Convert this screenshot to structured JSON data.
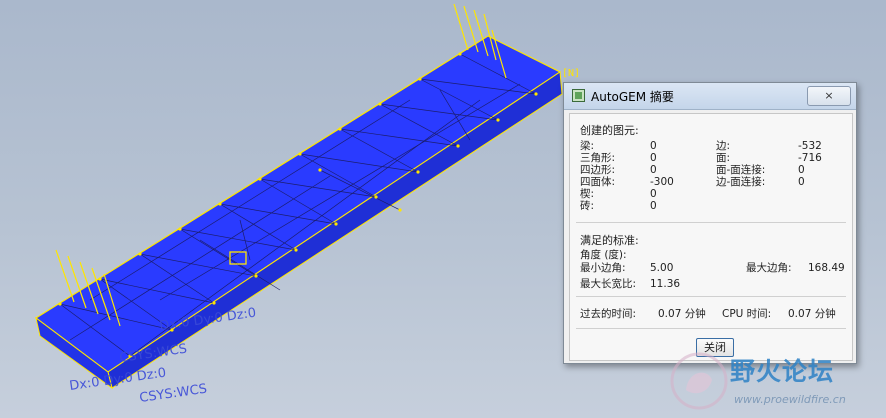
{
  "dialog": {
    "title": "AutoGEM 摘要",
    "close_label": "×",
    "created_heading": "创建的图元:",
    "created_left": [
      {
        "label": "梁:",
        "value": "0"
      },
      {
        "label": "三角形:",
        "value": "0"
      },
      {
        "label": "四边形:",
        "value": "0"
      },
      {
        "label": "四面体:",
        "value": "-300"
      },
      {
        "label": "楔:",
        "value": "0"
      },
      {
        "label": "砖:",
        "value": "0"
      }
    ],
    "created_right": [
      {
        "label": "边:",
        "value": "-532"
      },
      {
        "label": "面:",
        "value": "-716"
      },
      {
        "label": "面-面连接:",
        "value": "0"
      },
      {
        "label": "边-面连接:",
        "value": "0"
      }
    ],
    "criteria_heading": "满足的标准:",
    "angle_label": "角度 (度):",
    "min_edge_angle_label": "最小边角:",
    "min_edge_angle_value": "5.00",
    "max_edge_angle_label": "最大边角:",
    "max_edge_angle_value": "168.49",
    "max_aspect_label": "最大长宽比:",
    "max_aspect_value": "11.36",
    "elapsed_label": "过去的时间:",
    "elapsed_value": "0.07 分钟",
    "cpu_label": "CPU 时间:",
    "cpu_value": "0.07 分钟",
    "ok_label": "关闭"
  },
  "viewport": {
    "mesh_color": "#2a3bff",
    "edge_color": "#ffe600",
    "load_label_color": "#3b4bd8",
    "axis_label": "[N]",
    "load_labels": [
      "Dx:0 Dy:0 Dz:0",
      "CSYS:WCS"
    ]
  },
  "watermark": {
    "text": "野火论坛",
    "url": "www.proewildfire.cn"
  }
}
